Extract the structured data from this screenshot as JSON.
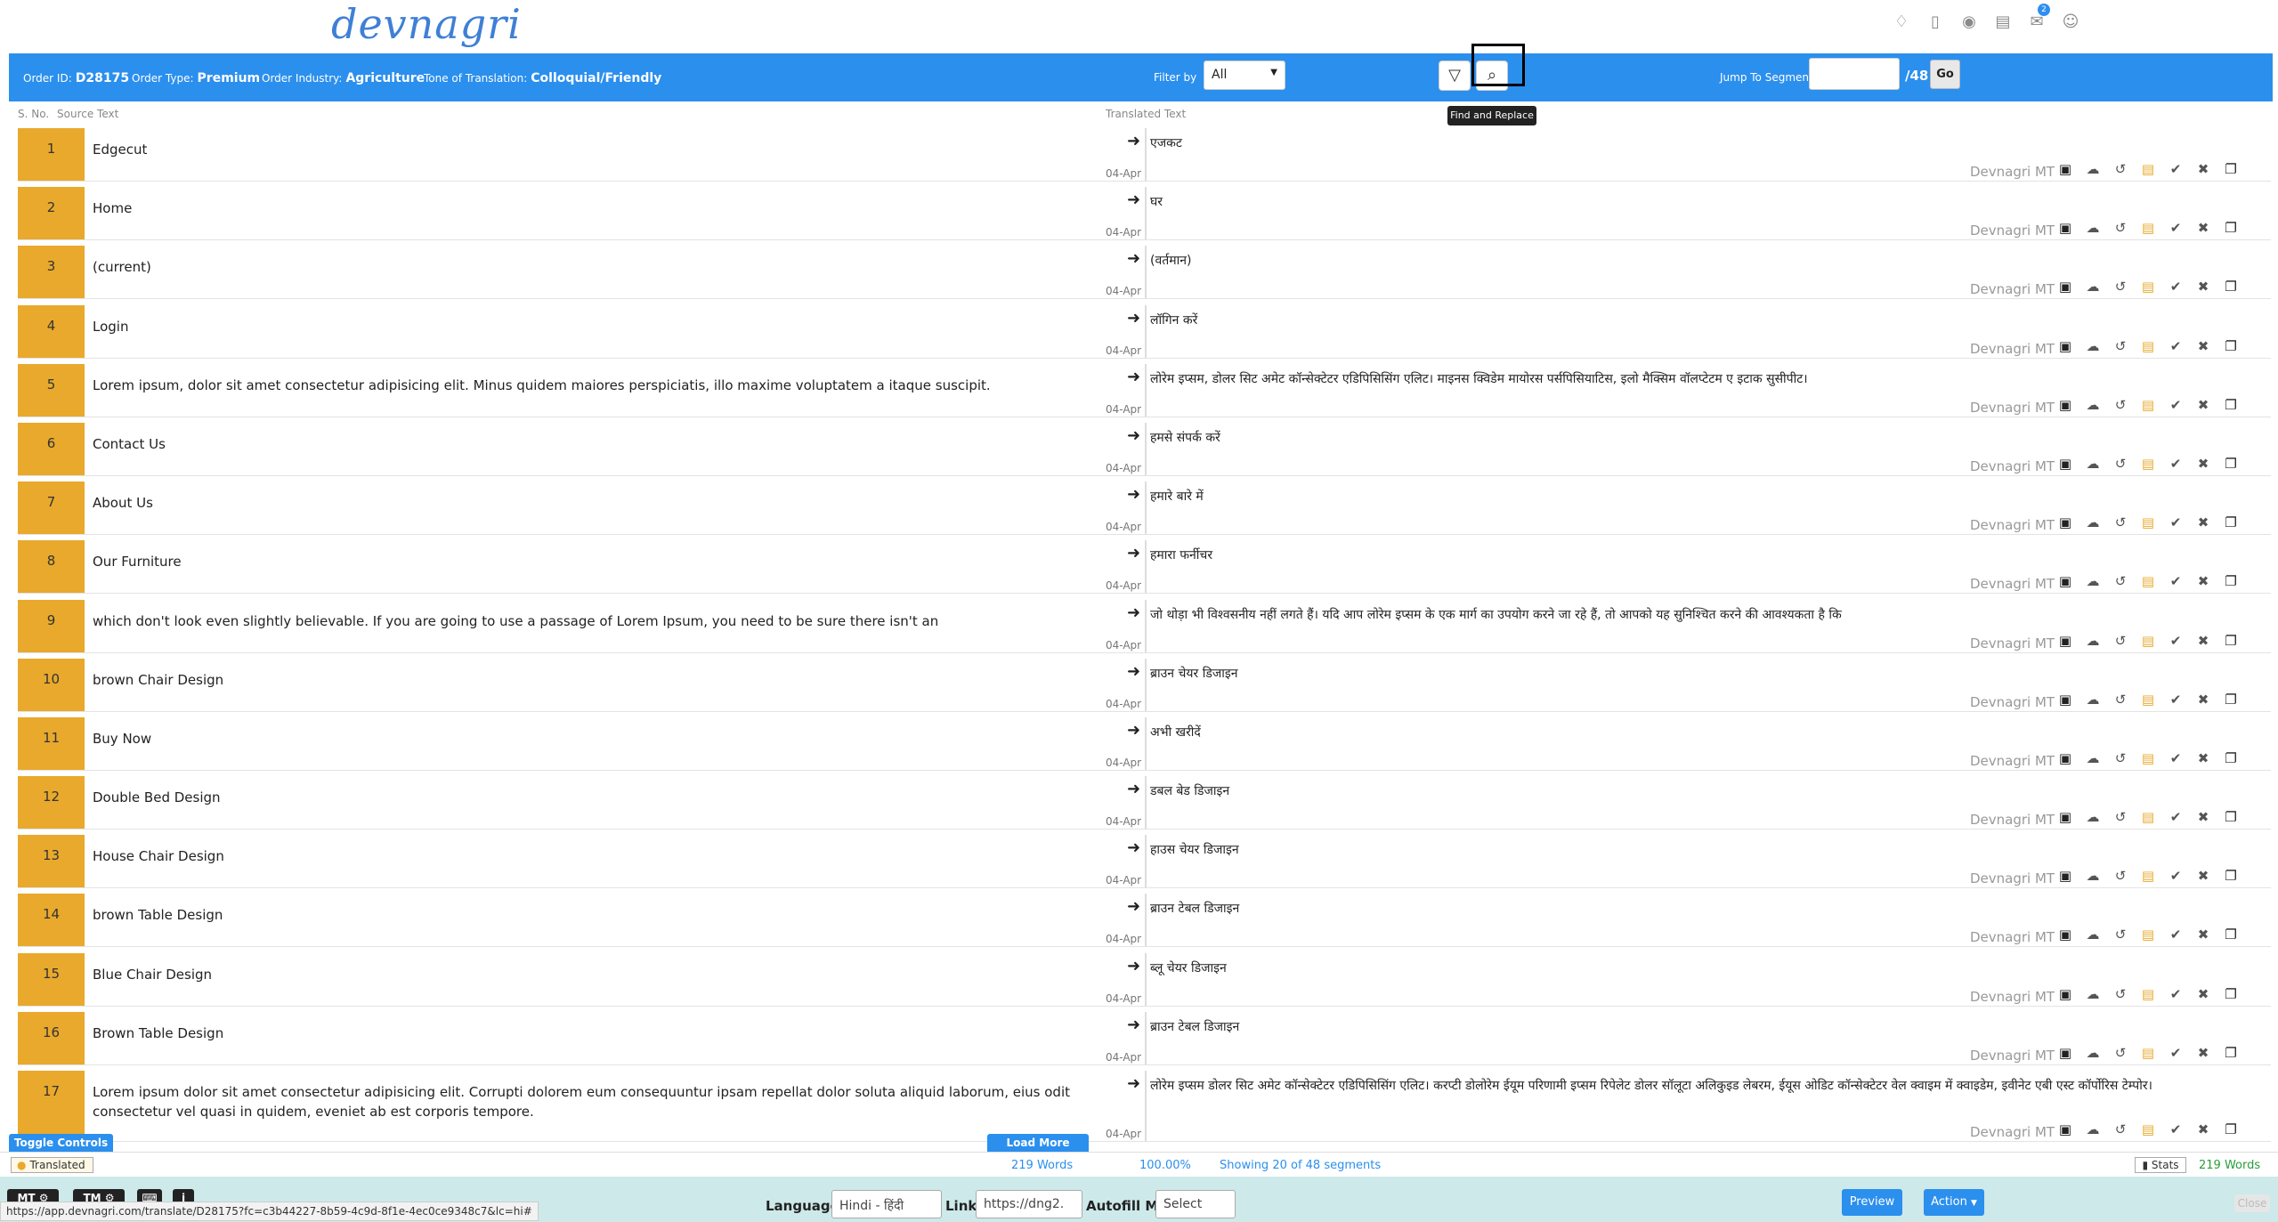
{
  "header": {
    "logo": "devnagri",
    "notification_count": "2",
    "icons": [
      "network-icon",
      "mobile-icon",
      "globe-icon",
      "document-icon",
      "mail-icon",
      "user-icon"
    ]
  },
  "infobar": {
    "order_id_label": "Order ID:",
    "order_id": "D28175",
    "order_type_label": "Order Type:",
    "order_type": "Premium",
    "industry_label": "Order Industry:",
    "industry": "Agriculture",
    "tone_label": "Tone of Translation:",
    "tone": "Colloquial/Friendly",
    "filter_label": "Filter by",
    "filter_value": "All",
    "tooltip": "Find and Replace",
    "jump_label": "Jump To Segment",
    "jump_total": "/48",
    "go_label": "Go"
  },
  "columns": {
    "sno": "S. No.",
    "source": "Source Text",
    "translated": "Translated Text"
  },
  "rows": [
    {
      "num": "1",
      "source": "Edgecut",
      "target": "एजकट",
      "date": "04-Apr",
      "engine": "Devnagri MT"
    },
    {
      "num": "2",
      "source": "Home",
      "target": "घर",
      "date": "04-Apr",
      "engine": "Devnagri MT"
    },
    {
      "num": "3",
      "source": "(current)",
      "target": "(वर्तमान)",
      "date": "04-Apr",
      "engine": "Devnagri MT"
    },
    {
      "num": "4",
      "source": "Login",
      "target": "लॉगिन करें",
      "date": "04-Apr",
      "engine": "Devnagri MT"
    },
    {
      "num": "5",
      "source": "Lorem ipsum, dolor sit amet consectetur adipisicing elit. Minus quidem maiores perspiciatis, illo maxime voluptatem a itaque suscipit.",
      "target": "लोरेम इप्सम, डोलर सिट अमेट कॉन्सेक्टेटर एडिपिसिसिंग एलिट। माइनस क्विडेम मायोरस पर्सपिसियाटिस, इलो मैक्सिम वॉलप्टेटम ए इटाक सुसीपीट।",
      "date": "04-Apr",
      "engine": "Devnagri MT"
    },
    {
      "num": "6",
      "source": "Contact Us",
      "target": "हमसे संपर्क करें",
      "date": "04-Apr",
      "engine": "Devnagri MT"
    },
    {
      "num": "7",
      "source": "About Us",
      "target": "हमारे बारे में",
      "date": "04-Apr",
      "engine": "Devnagri MT"
    },
    {
      "num": "8",
      "source": "Our Furniture",
      "target": "हमारा फर्नीचर",
      "date": "04-Apr",
      "engine": "Devnagri MT"
    },
    {
      "num": "9",
      "source": "which don't look even slightly believable. If you are going to use a passage of Lorem Ipsum, you need to be sure there isn't an",
      "target": "जो थोड़ा भी विश्वसनीय नहीं लगते हैं। यदि आप लोरेम इप्सम के एक मार्ग का उपयोग करने जा रहे हैं, तो आपको यह सुनिश्चित करने की आवश्यकता है कि",
      "date": "04-Apr",
      "engine": "Devnagri MT"
    },
    {
      "num": "10",
      "source": "brown Chair Design",
      "target": "ब्राउन चेयर डिजाइन",
      "date": "04-Apr",
      "engine": "Devnagri MT"
    },
    {
      "num": "11",
      "source": "Buy Now",
      "target": "अभी खरीदें",
      "date": "04-Apr",
      "engine": "Devnagri MT"
    },
    {
      "num": "12",
      "source": "Double Bed Design",
      "target": "डबल बेड डिजाइन",
      "date": "04-Apr",
      "engine": "Devnagri MT"
    },
    {
      "num": "13",
      "source": "House Chair Design",
      "target": "हाउस चेयर डिजाइन",
      "date": "04-Apr",
      "engine": "Devnagri MT"
    },
    {
      "num": "14",
      "source": "brown Table Design",
      "target": "ब्राउन टेबल डिजाइन",
      "date": "04-Apr",
      "engine": "Devnagri MT"
    },
    {
      "num": "15",
      "source": "Blue Chair Design",
      "target": "ब्लू चेयर डिजाइन",
      "date": "04-Apr",
      "engine": "Devnagri MT"
    },
    {
      "num": "16",
      "source": "Brown Table Design",
      "target": "ब्राउन टेबल डिजाइन",
      "date": "04-Apr",
      "engine": "Devnagri MT"
    },
    {
      "num": "17",
      "source": "Lorem ipsum dolor sit amet consectetur adipisicing elit. Corrupti dolorem eum consequuntur ipsam repellat dolor soluta aliquid laborum, eius odit consectetur vel quasi in quidem, eveniet ab est corporis tempore.",
      "target": "लोरेम इप्सम डोलर सिट अमेट कॉन्सेक्टेटर एडिपिसिसिंग एलिट। करप्टी डोलोरेम ईयूम परिणामी इप्सम रिपेलेट डोलर सॉलूटा अलिकुइड लेबरम, ईयूस ओडिट कॉन्सेक्टेटर वेल क्वाइम में क्वाइडेम, इवीनेट एबी एस्ट कॉर्पोरिस टेम्पोर।",
      "date": "04-Apr",
      "engine": "Devnagri MT"
    }
  ],
  "bottom": {
    "toggle_label": "Toggle Controls",
    "load_more_label": "Load More",
    "translated_label": "Translated",
    "words": "219 Words",
    "percent": "100.00%",
    "showing": "Showing 20 of 48 segments",
    "stats_label": "Stats",
    "stats_words": "219 Words",
    "mt_label": "MT",
    "tm_label": "TM",
    "language_label": "Language",
    "language_value": "Hindi - हिंदी",
    "link_label": "Link",
    "link_value": "https://dng2.",
    "autofill_label": "Autofill MT",
    "autofill_value": "Select",
    "preview_label": "Preview",
    "action_label": "Action",
    "close_label": "Close",
    "url_tip": "https://app.devnagri.com/translate/D28175?fc=c3b44227-8b59-4c9d-8f1e-4ec0ce9348c7&lc=hi#"
  }
}
